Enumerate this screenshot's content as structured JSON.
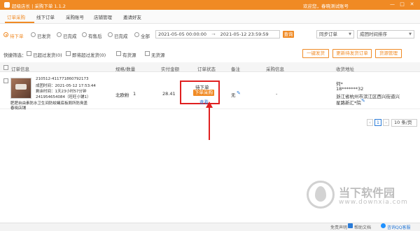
{
  "app": {
    "title": "超级店长 | 采购下单 1.1.2",
    "user": "欢迎您，春晓测试账号"
  },
  "window_controls": [
    "—",
    "□",
    "✕"
  ],
  "tabs": [
    {
      "label": "订单采购",
      "active": true
    },
    {
      "label": "线下订单",
      "active": false
    },
    {
      "label": "采购账号",
      "active": false
    },
    {
      "label": "店铺管理",
      "active": false
    },
    {
      "label": "邀请好友",
      "active": false
    }
  ],
  "status_filter": {
    "options": [
      {
        "label": "待下单",
        "checked": true
      },
      {
        "label": "已发货",
        "checked": false
      },
      {
        "label": "已完成",
        "checked": false
      },
      {
        "label": "有售后",
        "checked": false
      },
      {
        "label": "已完成",
        "checked": false
      },
      {
        "label": "全部",
        "checked": false
      }
    ]
  },
  "date_range": {
    "start": "2021-05-05 00:00:00",
    "separator": "→",
    "end": "2021-05-12 23:59:59"
  },
  "search_button": "查询",
  "sync_select": "同步订单",
  "sort_select": "成团时间排序",
  "quick_filter": {
    "label": "快捷筛选：",
    "options": [
      "已超过发货(0)",
      "即将超过发货(0)",
      "有货源",
      "无货源"
    ]
  },
  "actions": {
    "one_click": "一键发货",
    "batch": "更新待发货订单",
    "source": "货源管理"
  },
  "table": {
    "headers": [
      "订单信息",
      "规格/数量",
      "实付金额",
      "订单状态",
      "备注",
      "采购信息",
      "收货地址"
    ],
    "row": {
      "order_no": "210512-411771860792173",
      "time": "成团时间：2021-05-12 17:53:44",
      "deadline": "剩余时间：1天23小时57分钟",
      "seller": "241954654084（旺旺小铺1）",
      "title": "肥肥自由素防水卫生间防蚊蝇底板厕所防臭盖",
      "title2": "春晓店铺",
      "spec": "北欧粉",
      "qty": "1",
      "amount": "28.41",
      "status": "待下单",
      "order_btn": "下单采购",
      "detail_link": "查看",
      "remark": "无",
      "purchase": "-",
      "receiver": "何*",
      "phone": "18*******32",
      "address1": "浙江省杭州市滨江区西兴街道兴",
      "address2": "星路新汇*院"
    }
  },
  "pagination": {
    "prev": "‹",
    "page": "1",
    "next": "›",
    "page_size": "10 条/页"
  },
  "statusbar": {
    "disclaimer": "免责声明",
    "help": "帮助文档",
    "qq": "咨询QQ客服"
  },
  "watermark": {
    "text": "当下软件园",
    "url": "www.downxia.com"
  },
  "colors": {
    "brand": "#f08a24",
    "highlight": "#e02020"
  }
}
